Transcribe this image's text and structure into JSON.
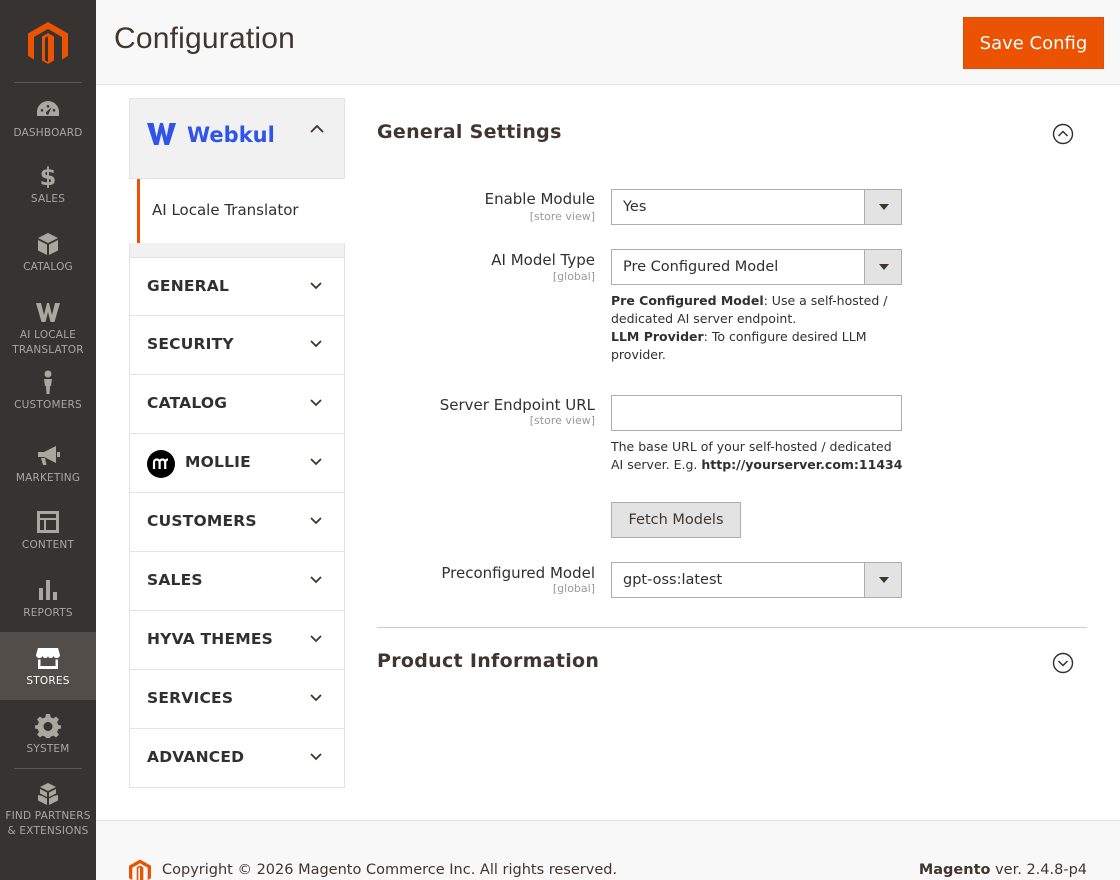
{
  "nav": {
    "items": [
      {
        "label": "DASHBOARD",
        "icon": "dashboard-icon"
      },
      {
        "label": "SALES",
        "icon": "dollar-icon"
      },
      {
        "label": "CATALOG",
        "icon": "box-icon"
      },
      {
        "label": "AI LOCALE\nTRANSLATOR",
        "icon": "webkul-icon"
      },
      {
        "label": "CUSTOMERS",
        "icon": "person-icon"
      },
      {
        "label": "MARKETING",
        "icon": "megaphone-icon"
      },
      {
        "label": "CONTENT",
        "icon": "layout-icon"
      },
      {
        "label": "REPORTS",
        "icon": "bar-chart-icon"
      },
      {
        "label": "STORES",
        "icon": "store-icon"
      },
      {
        "label": "SYSTEM",
        "icon": "gear-icon"
      },
      {
        "label": "FIND PARTNERS\n& EXTENSIONS",
        "icon": "boxes-icon"
      }
    ],
    "active": "STORES"
  },
  "header": {
    "title": "Configuration",
    "save_label": "Save Config"
  },
  "tabs": {
    "vendor": {
      "brand": "Webkul",
      "sub_item": "AI Locale Translator"
    },
    "groups": [
      {
        "label": "GENERAL"
      },
      {
        "label": "SECURITY"
      },
      {
        "label": "CATALOG"
      },
      {
        "label": "MOLLIE"
      },
      {
        "label": "CUSTOMERS"
      },
      {
        "label": "SALES"
      },
      {
        "label": "HYVA THEMES"
      },
      {
        "label": "SERVICES"
      },
      {
        "label": "ADVANCED"
      }
    ]
  },
  "general": {
    "title": "General Settings",
    "enable_module": {
      "label": "Enable Module",
      "scope": "[store view]",
      "value": "Yes"
    },
    "ai_model_type": {
      "label": "AI Model Type",
      "scope": "[global]",
      "value": "Pre Configured Model",
      "note_1_bold": "Pre Configured Model",
      "note_1": ": Use a self-hosted / dedicated AI server endpoint.",
      "note_2_bold": "LLM Provider",
      "note_2": ": To configure desired LLM provider."
    },
    "server_endpoint": {
      "label": "Server Endpoint URL",
      "scope": "[store view]",
      "value": "",
      "note": "The base URL of your self-hosted / dedicated AI server. E.g. ",
      "note_bold": "http://yourserver.com:11434"
    },
    "fetch_label": "Fetch Models",
    "preconfigured_model": {
      "label": "Preconfigured Model",
      "scope": "[global]",
      "value": "gpt-oss:latest"
    }
  },
  "product": {
    "title": "Product Information"
  },
  "footer": {
    "copyright": "Copyright © 2026 Magento Commerce Inc. All rights reserved.",
    "brand": "Magento",
    "version": " ver. 2.4.8-p4"
  },
  "colors": {
    "accent": "#eb5202",
    "nav_bg": "#373330",
    "webkul_blue": "#2f54eb"
  }
}
